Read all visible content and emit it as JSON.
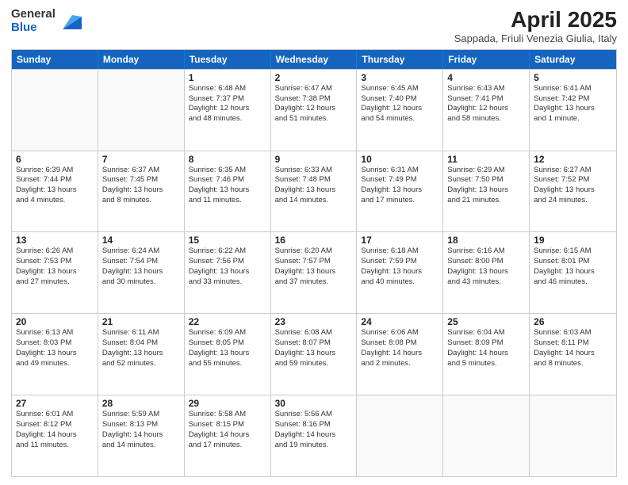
{
  "logo": {
    "general": "General",
    "blue": "Blue"
  },
  "title": "April 2025",
  "subtitle": "Sappada, Friuli Venezia Giulia, Italy",
  "weekdays": [
    "Sunday",
    "Monday",
    "Tuesday",
    "Wednesday",
    "Thursday",
    "Friday",
    "Saturday"
  ],
  "weeks": [
    [
      {
        "day": "",
        "info": ""
      },
      {
        "day": "",
        "info": ""
      },
      {
        "day": "1",
        "info": "Sunrise: 6:48 AM\nSunset: 7:37 PM\nDaylight: 12 hours\nand 48 minutes."
      },
      {
        "day": "2",
        "info": "Sunrise: 6:47 AM\nSunset: 7:38 PM\nDaylight: 12 hours\nand 51 minutes."
      },
      {
        "day": "3",
        "info": "Sunrise: 6:45 AM\nSunset: 7:40 PM\nDaylight: 12 hours\nand 54 minutes."
      },
      {
        "day": "4",
        "info": "Sunrise: 6:43 AM\nSunset: 7:41 PM\nDaylight: 12 hours\nand 58 minutes."
      },
      {
        "day": "5",
        "info": "Sunrise: 6:41 AM\nSunset: 7:42 PM\nDaylight: 13 hours\nand 1 minute."
      }
    ],
    [
      {
        "day": "6",
        "info": "Sunrise: 6:39 AM\nSunset: 7:44 PM\nDaylight: 13 hours\nand 4 minutes."
      },
      {
        "day": "7",
        "info": "Sunrise: 6:37 AM\nSunset: 7:45 PM\nDaylight: 13 hours\nand 8 minutes."
      },
      {
        "day": "8",
        "info": "Sunrise: 6:35 AM\nSunset: 7:46 PM\nDaylight: 13 hours\nand 11 minutes."
      },
      {
        "day": "9",
        "info": "Sunrise: 6:33 AM\nSunset: 7:48 PM\nDaylight: 13 hours\nand 14 minutes."
      },
      {
        "day": "10",
        "info": "Sunrise: 6:31 AM\nSunset: 7:49 PM\nDaylight: 13 hours\nand 17 minutes."
      },
      {
        "day": "11",
        "info": "Sunrise: 6:29 AM\nSunset: 7:50 PM\nDaylight: 13 hours\nand 21 minutes."
      },
      {
        "day": "12",
        "info": "Sunrise: 6:27 AM\nSunset: 7:52 PM\nDaylight: 13 hours\nand 24 minutes."
      }
    ],
    [
      {
        "day": "13",
        "info": "Sunrise: 6:26 AM\nSunset: 7:53 PM\nDaylight: 13 hours\nand 27 minutes."
      },
      {
        "day": "14",
        "info": "Sunrise: 6:24 AM\nSunset: 7:54 PM\nDaylight: 13 hours\nand 30 minutes."
      },
      {
        "day": "15",
        "info": "Sunrise: 6:22 AM\nSunset: 7:56 PM\nDaylight: 13 hours\nand 33 minutes."
      },
      {
        "day": "16",
        "info": "Sunrise: 6:20 AM\nSunset: 7:57 PM\nDaylight: 13 hours\nand 37 minutes."
      },
      {
        "day": "17",
        "info": "Sunrise: 6:18 AM\nSunset: 7:59 PM\nDaylight: 13 hours\nand 40 minutes."
      },
      {
        "day": "18",
        "info": "Sunrise: 6:16 AM\nSunset: 8:00 PM\nDaylight: 13 hours\nand 43 minutes."
      },
      {
        "day": "19",
        "info": "Sunrise: 6:15 AM\nSunset: 8:01 PM\nDaylight: 13 hours\nand 46 minutes."
      }
    ],
    [
      {
        "day": "20",
        "info": "Sunrise: 6:13 AM\nSunset: 8:03 PM\nDaylight: 13 hours\nand 49 minutes."
      },
      {
        "day": "21",
        "info": "Sunrise: 6:11 AM\nSunset: 8:04 PM\nDaylight: 13 hours\nand 52 minutes."
      },
      {
        "day": "22",
        "info": "Sunrise: 6:09 AM\nSunset: 8:05 PM\nDaylight: 13 hours\nand 55 minutes."
      },
      {
        "day": "23",
        "info": "Sunrise: 6:08 AM\nSunset: 8:07 PM\nDaylight: 13 hours\nand 59 minutes."
      },
      {
        "day": "24",
        "info": "Sunrise: 6:06 AM\nSunset: 8:08 PM\nDaylight: 14 hours\nand 2 minutes."
      },
      {
        "day": "25",
        "info": "Sunrise: 6:04 AM\nSunset: 8:09 PM\nDaylight: 14 hours\nand 5 minutes."
      },
      {
        "day": "26",
        "info": "Sunrise: 6:03 AM\nSunset: 8:11 PM\nDaylight: 14 hours\nand 8 minutes."
      }
    ],
    [
      {
        "day": "27",
        "info": "Sunrise: 6:01 AM\nSunset: 8:12 PM\nDaylight: 14 hours\nand 11 minutes."
      },
      {
        "day": "28",
        "info": "Sunrise: 5:59 AM\nSunset: 8:13 PM\nDaylight: 14 hours\nand 14 minutes."
      },
      {
        "day": "29",
        "info": "Sunrise: 5:58 AM\nSunset: 8:15 PM\nDaylight: 14 hours\nand 17 minutes."
      },
      {
        "day": "30",
        "info": "Sunrise: 5:56 AM\nSunset: 8:16 PM\nDaylight: 14 hours\nand 19 minutes."
      },
      {
        "day": "",
        "info": ""
      },
      {
        "day": "",
        "info": ""
      },
      {
        "day": "",
        "info": ""
      }
    ]
  ]
}
